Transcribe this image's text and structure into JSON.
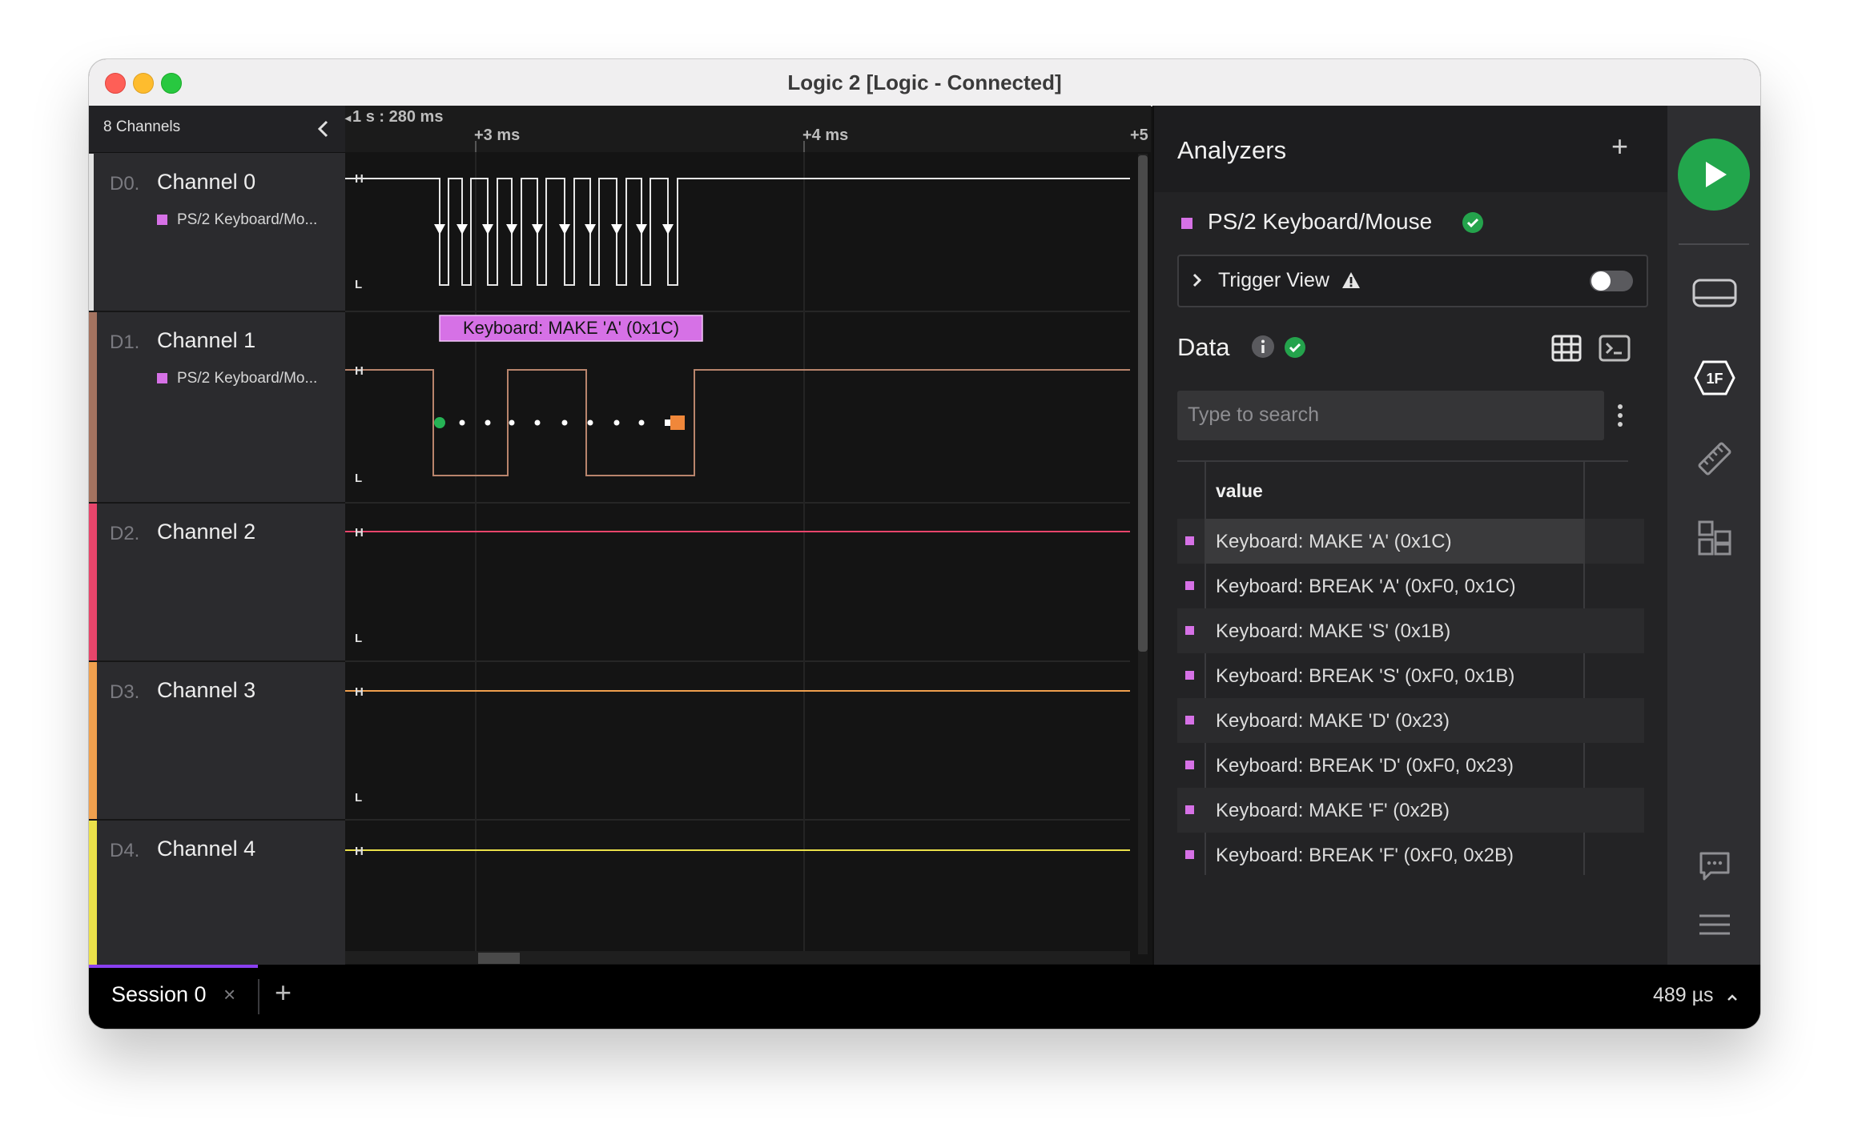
{
  "window": {
    "title": "Logic 2 [Logic - Connected]"
  },
  "sidebar": {
    "channels_label": "8 Channels",
    "channels": [
      {
        "index": "D0.",
        "name": "Channel 0",
        "analyzer": "PS/2 Keyboard/Mo...",
        "color": "#9a9a9a"
      },
      {
        "index": "D1.",
        "name": "Channel 1",
        "analyzer": "PS/2 Keyboard/Mo...",
        "color": "#a47360"
      },
      {
        "index": "D2.",
        "name": "Channel 2",
        "analyzer": "",
        "color": "#e8456b"
      },
      {
        "index": "D3.",
        "name": "Channel 3",
        "analyzer": "",
        "color": "#f0a04e"
      },
      {
        "index": "D4.",
        "name": "Channel 4",
        "analyzer": "",
        "color": "#ebe14a"
      }
    ]
  },
  "timeline": {
    "origin": "1 s : 280 ms",
    "ticks": [
      "+3 ms",
      "+4 ms",
      "+5"
    ],
    "high_label": "H",
    "low_label": "L",
    "annotation": "Keyboard: MAKE 'A' (0x1C)"
  },
  "analyzers": {
    "title": "Analyzers",
    "add_label": "+",
    "analyzer_name": "PS/2 Keyboard/Mouse",
    "analyzer_color": "#d671e6",
    "trigger_view": "Trigger View",
    "trigger_enabled": false,
    "data_title": "Data",
    "search_placeholder": "Type to search",
    "column_header": "value",
    "rows": [
      "Keyboard: MAKE 'A' (0x1C)",
      "Keyboard: BREAK 'A' (0xF0, 0x1C)",
      "Keyboard: MAKE 'S' (0x1B)",
      "Keyboard: BREAK 'S' (0xF0, 0x1B)",
      "Keyboard: MAKE 'D' (0x23)",
      "Keyboard: BREAK 'D' (0xF0, 0x23)",
      "Keyboard: MAKE 'F' (0x2B)",
      "Keyboard: BREAK 'F' (0xF0, 0x2B)"
    ]
  },
  "rail": {
    "play_icon": "play-icon",
    "icons": [
      "device-icon",
      "analyzer-1f-icon",
      "measure-icon",
      "extensions-icon",
      "feedback-icon",
      "menu-icon"
    ],
    "analyzer_badge": "1F"
  },
  "bottom": {
    "session_tab": "Session 0",
    "close_label": "×",
    "add_label": "+",
    "time_readout": "489 µs"
  }
}
